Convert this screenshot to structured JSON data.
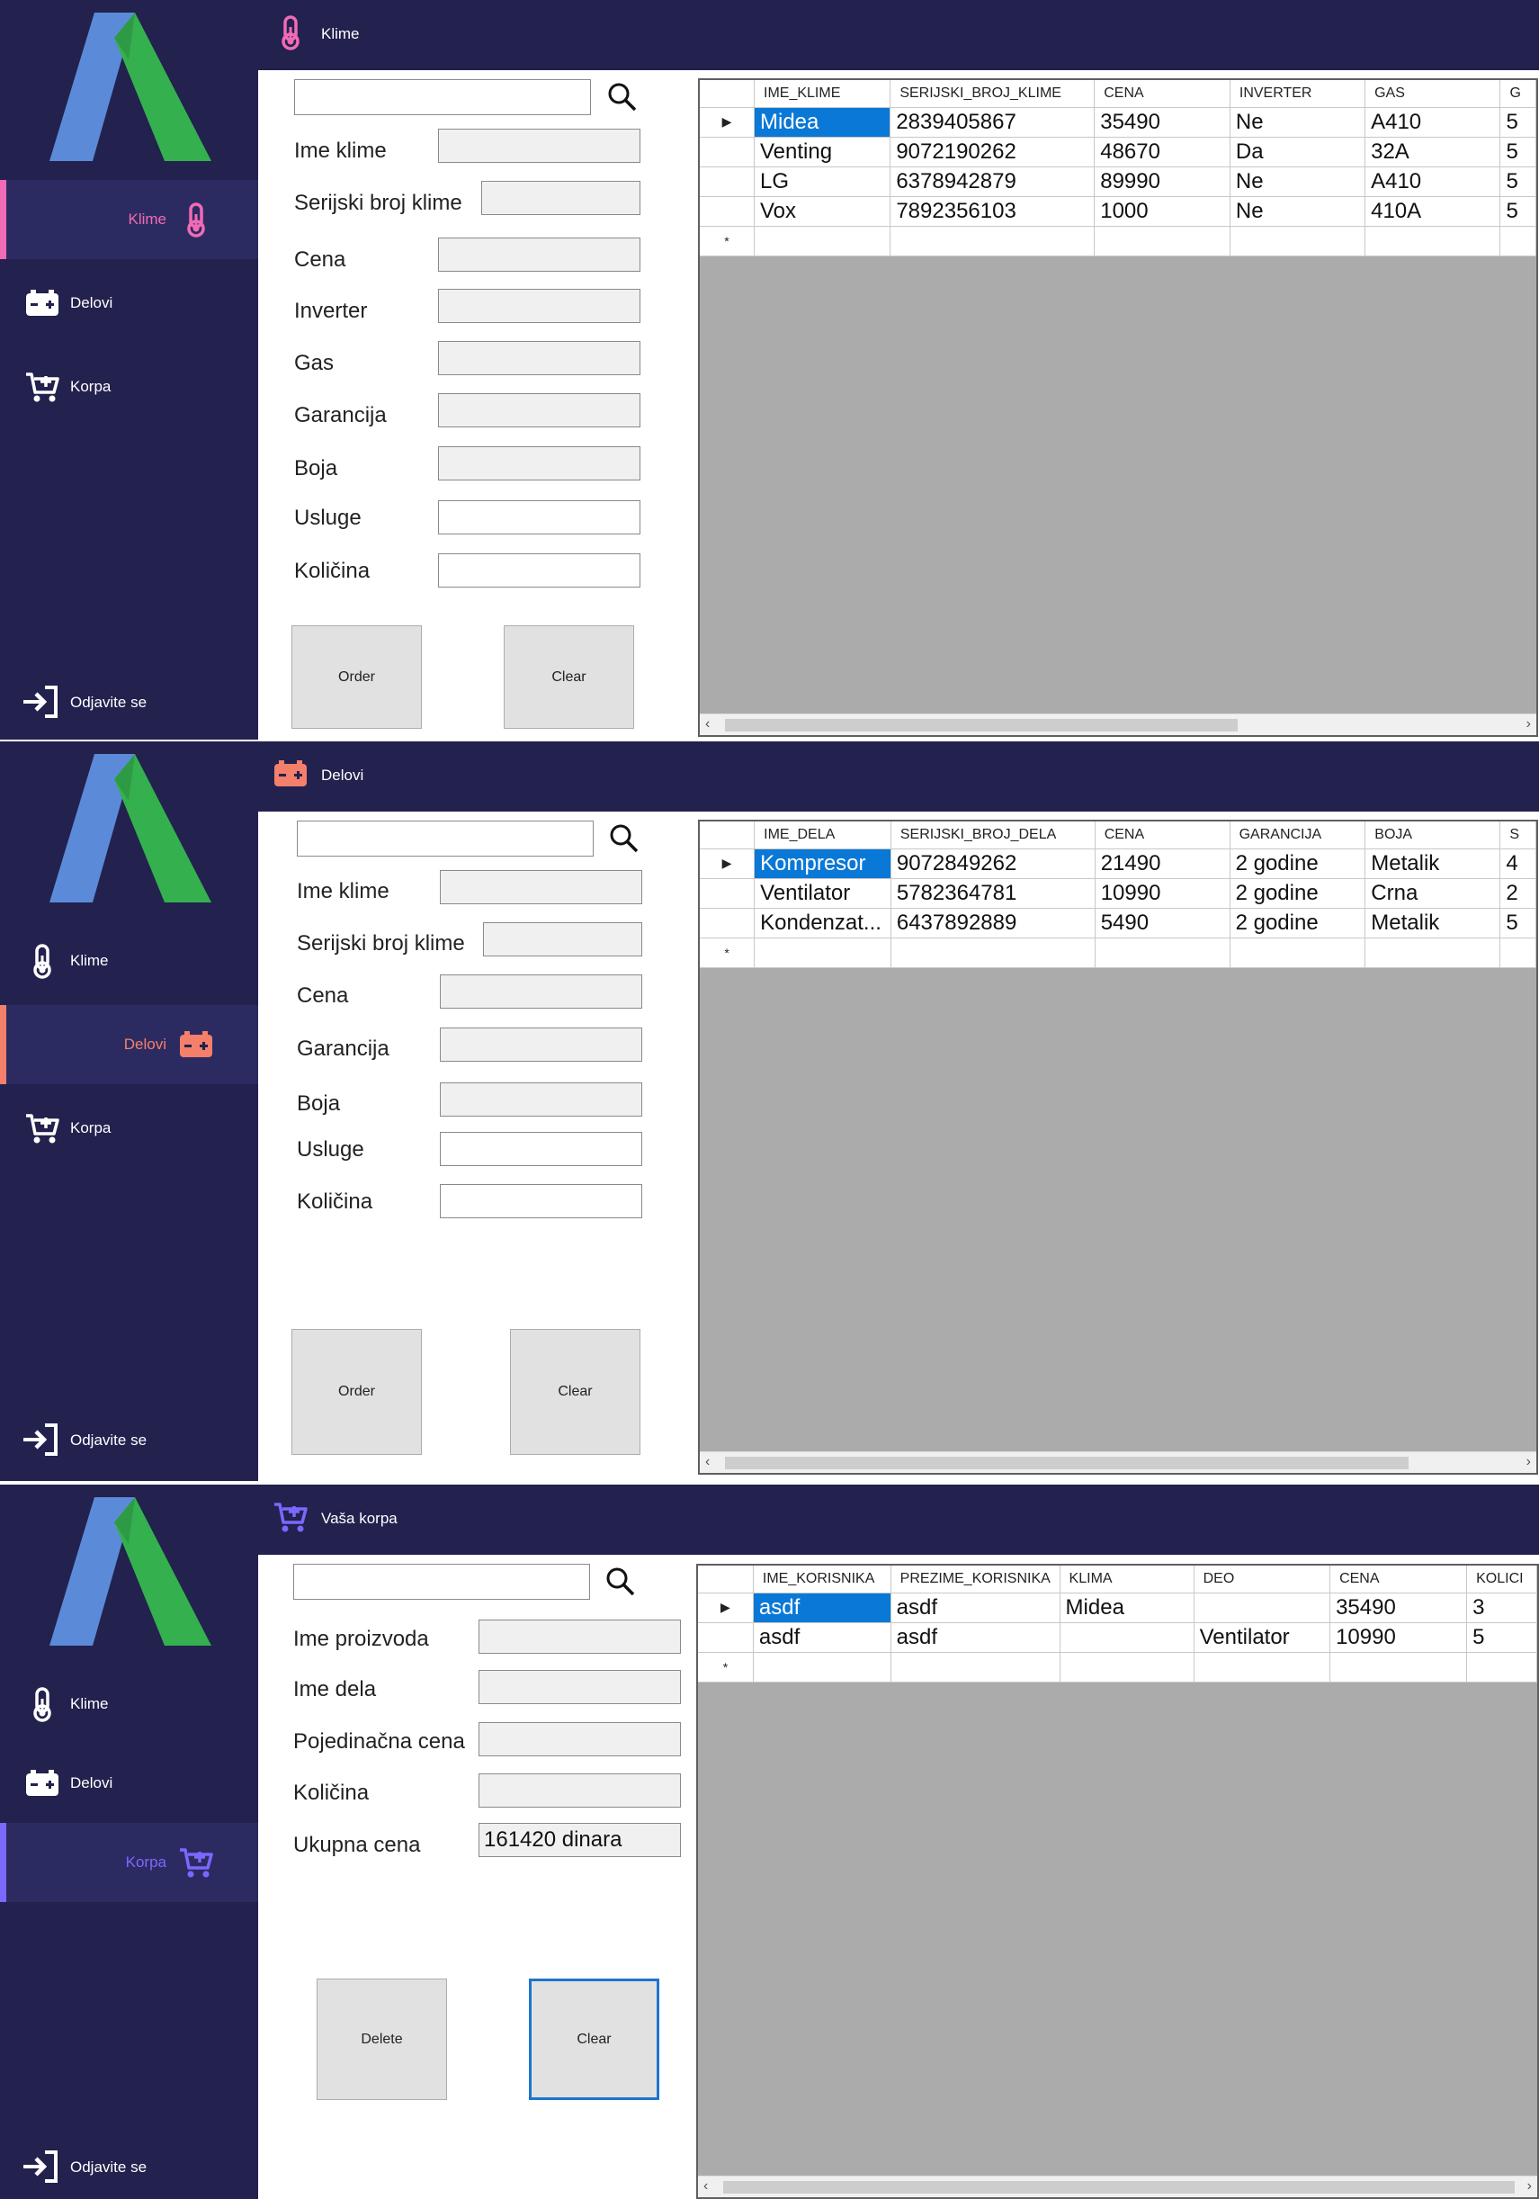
{
  "colors": {
    "sidebar_bg": "#23214e",
    "active_bg": "#2c2b61",
    "klime_accent": "#f06bb5",
    "delovi_accent": "#f4806b",
    "korpa_accent": "#7a68ff",
    "selection": "#0a78d7"
  },
  "nav": {
    "klime": "Klime",
    "delovi": "Delovi",
    "korpa": "Korpa",
    "logout": "Odjavite se"
  },
  "screen1": {
    "title": "Klime",
    "labels": [
      "Ime klime",
      "Serijski broj klime",
      "Cena",
      "Inverter",
      "Gas",
      "Garancija",
      "Boja",
      "Usluge",
      "Količina"
    ],
    "order_button": "Order",
    "clear_button": "Clear",
    "grid": {
      "columns": [
        "IME_KLIME",
        "SERIJSKI_BROJ_KLIME",
        "CENA",
        "INVERTER",
        "GAS",
        "G"
      ],
      "rows": [
        [
          "Midea",
          "2839405867",
          "35490",
          "Ne",
          "A410",
          "5"
        ],
        [
          "Venting",
          "9072190262",
          "48670",
          "Da",
          "32A",
          "5"
        ],
        [
          "LG",
          "6378942879",
          "89990",
          "Ne",
          "A410",
          "5"
        ],
        [
          "Vox",
          "7892356103",
          "1000",
          "Ne",
          "410A",
          "5"
        ]
      ]
    }
  },
  "screen2": {
    "title": "Delovi",
    "labels": [
      "Ime klime",
      "Serijski broj klime",
      "Cena",
      "Garancija",
      "Boja",
      "Usluge",
      "Količina"
    ],
    "order_button": "Order",
    "clear_button": "Clear",
    "grid": {
      "columns": [
        "IME_DELA",
        "SERIJSKI_BROJ_DELA",
        "CENA",
        "GARANCIJA",
        "BOJA",
        "S"
      ],
      "rows": [
        [
          "Kompresor",
          "9072849262",
          "21490",
          "2 godine",
          "Metalik",
          "4"
        ],
        [
          "Ventilator",
          "5782364781",
          "10990",
          "2 godine",
          "Crna",
          "2"
        ],
        [
          "Kondenzat...",
          "6437892889",
          "5490",
          "2 godine",
          "Metalik",
          "5"
        ]
      ]
    }
  },
  "screen3": {
    "title": "Vaša korpa",
    "labels": [
      "Ime proizvoda",
      "Ime dela",
      "Pojedinačna cena",
      "Količina",
      "Ukupna cena"
    ],
    "total_value": "161420 dinara",
    "delete_button": "Delete",
    "clear_button": "Clear",
    "grid": {
      "columns": [
        "IME_KORISNIKA",
        "PREZIME_KORISNIKA",
        "KLIMA",
        "DEO",
        "CENA",
        "KOLICI"
      ],
      "rows": [
        [
          "asdf",
          "asdf",
          "Midea",
          "",
          "35490",
          "3"
        ],
        [
          "asdf",
          "asdf",
          "",
          "Ventilator",
          "10990",
          "5"
        ]
      ]
    }
  }
}
